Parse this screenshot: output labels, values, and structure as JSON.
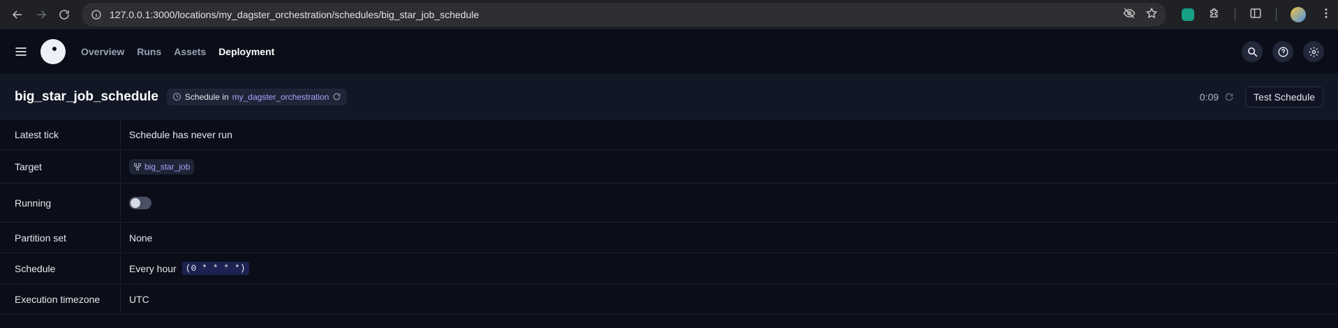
{
  "browser": {
    "url": "127.0.0.1:3000/locations/my_dagster_orchestration/schedules/big_star_job_schedule"
  },
  "nav": {
    "items": [
      {
        "label": "Overview",
        "active": false
      },
      {
        "label": "Runs",
        "active": false
      },
      {
        "label": "Assets",
        "active": false
      },
      {
        "label": "Deployment",
        "active": true
      }
    ]
  },
  "page": {
    "title": "big_star_job_schedule",
    "tag_prefix": "Schedule in",
    "tag_location": "my_dagster_orchestration",
    "timer": "0:09",
    "test_button": "Test Schedule"
  },
  "details": {
    "latest_tick_label": "Latest tick",
    "latest_tick_value": "Schedule has never run",
    "target_label": "Target",
    "target_value": "big_star_job",
    "running_label": "Running",
    "running_on": false,
    "partition_label": "Partition set",
    "partition_value": "None",
    "schedule_label": "Schedule",
    "schedule_value": "Every hour",
    "schedule_cron": "(0 * * * *)",
    "timezone_label": "Execution timezone",
    "timezone_value": "UTC"
  },
  "colors": {
    "background": "#0b0e18",
    "link": "#a9a3ff",
    "header_band": "#121726"
  }
}
